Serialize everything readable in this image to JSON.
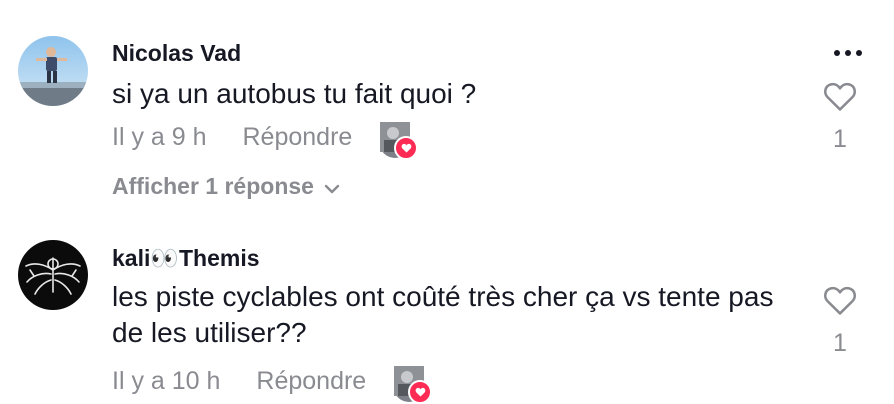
{
  "comments": [
    {
      "username": "Nicolas Vad",
      "text": "si ya un autobus tu fait quoi ?",
      "time": "Il y a 9 h",
      "reply_label": "Répondre",
      "like_count": "1",
      "view_replies": "Afficher 1 réponse"
    },
    {
      "username": "kali👀Themis",
      "text": "les piste cyclables ont coûté très cher ça vs tente pas de les utiliser??",
      "time": "Il y a 10 h",
      "reply_label": "Répondre",
      "like_count": "1"
    }
  ],
  "colors": {
    "text_primary": "#161823",
    "text_secondary": "#8a8b91",
    "like_heart_badge": "#fe2c55"
  },
  "icons": {
    "more": "more-options-icon",
    "like": "heart-outline-icon",
    "expand": "chevron-down-icon",
    "creator_liked": "creator-liked-heart-icon"
  }
}
